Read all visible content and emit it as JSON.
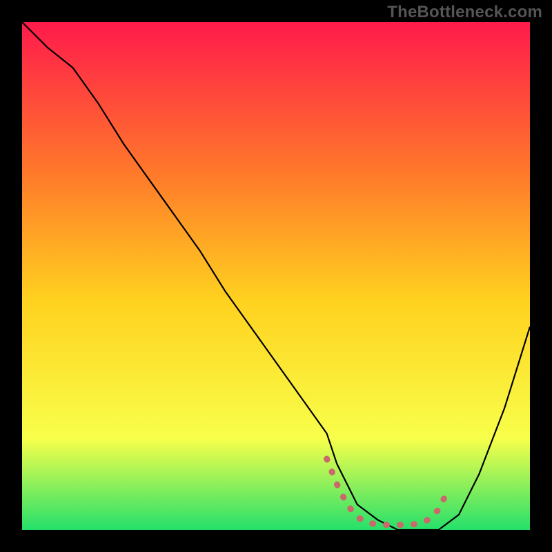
{
  "watermark": "TheBottleneck.com",
  "chart_data": {
    "type": "line",
    "title": "",
    "xlabel": "",
    "ylabel": "",
    "xlim": [
      0,
      100
    ],
    "ylim": [
      0,
      100
    ],
    "grid": false,
    "background_gradient": {
      "top": "#ff1a4b",
      "upper_mid": "#ff7a2a",
      "mid": "#ffd21f",
      "lower_mid": "#f8ff4a",
      "bottom": "#25e06b"
    },
    "series": [
      {
        "name": "black-curve",
        "color": "#000000",
        "x": [
          0,
          5,
          10,
          15,
          20,
          25,
          30,
          35,
          40,
          45,
          50,
          55,
          60,
          62,
          66,
          70,
          74,
          78,
          82,
          86,
          90,
          95,
          100
        ],
        "y": [
          100,
          95,
          91,
          84,
          76,
          69,
          62,
          55,
          47,
          40,
          33,
          26,
          19,
          13,
          5,
          2,
          0,
          0,
          0,
          3,
          11,
          24,
          40
        ]
      },
      {
        "name": "red-dash",
        "color": "#c96a6a",
        "style": "dotted",
        "x": [
          60,
          62,
          64,
          66,
          68,
          70,
          72,
          74,
          76,
          78,
          80,
          82,
          84
        ],
        "y": [
          14,
          9,
          5,
          2.5,
          1.5,
          1,
          1,
          1,
          1,
          1.2,
          2,
          4,
          8
        ]
      }
    ]
  },
  "colors": {
    "frame": "#000000",
    "watermark": "#555555"
  }
}
